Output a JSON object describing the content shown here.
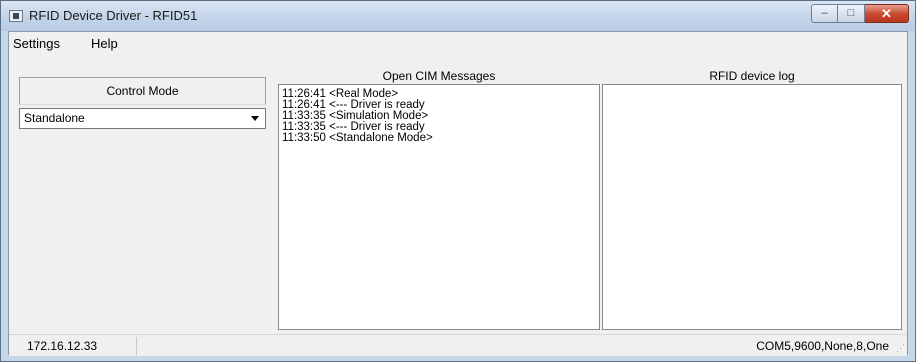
{
  "window": {
    "title": "RFID Device Driver - RFID51",
    "controls": {
      "minimize": "–",
      "maximize": "□",
      "close": "✕"
    }
  },
  "menu": {
    "items": [
      {
        "label": "Settings"
      },
      {
        "label": "Help"
      }
    ]
  },
  "control_panel": {
    "header": "Control Mode",
    "mode_select": {
      "value": "Standalone"
    }
  },
  "cim_messages": {
    "header": "Open CIM Messages",
    "lines": [
      "11:26:41 <Real Mode>",
      "11:26:41 <--- Driver is ready",
      "11:33:35 <Simulation Mode>",
      "11:33:35 <--- Driver is ready",
      "11:33:50 <Standalone Mode>"
    ]
  },
  "device_log": {
    "header": "RFID device log",
    "lines": []
  },
  "status": {
    "ip": "172.16.12.33",
    "port_settings": "COM5,9600,None,8,One"
  },
  "icons": {
    "app": "app-icon",
    "dropdown": "chevron-down-icon",
    "grip": "resize-grip-icon"
  }
}
